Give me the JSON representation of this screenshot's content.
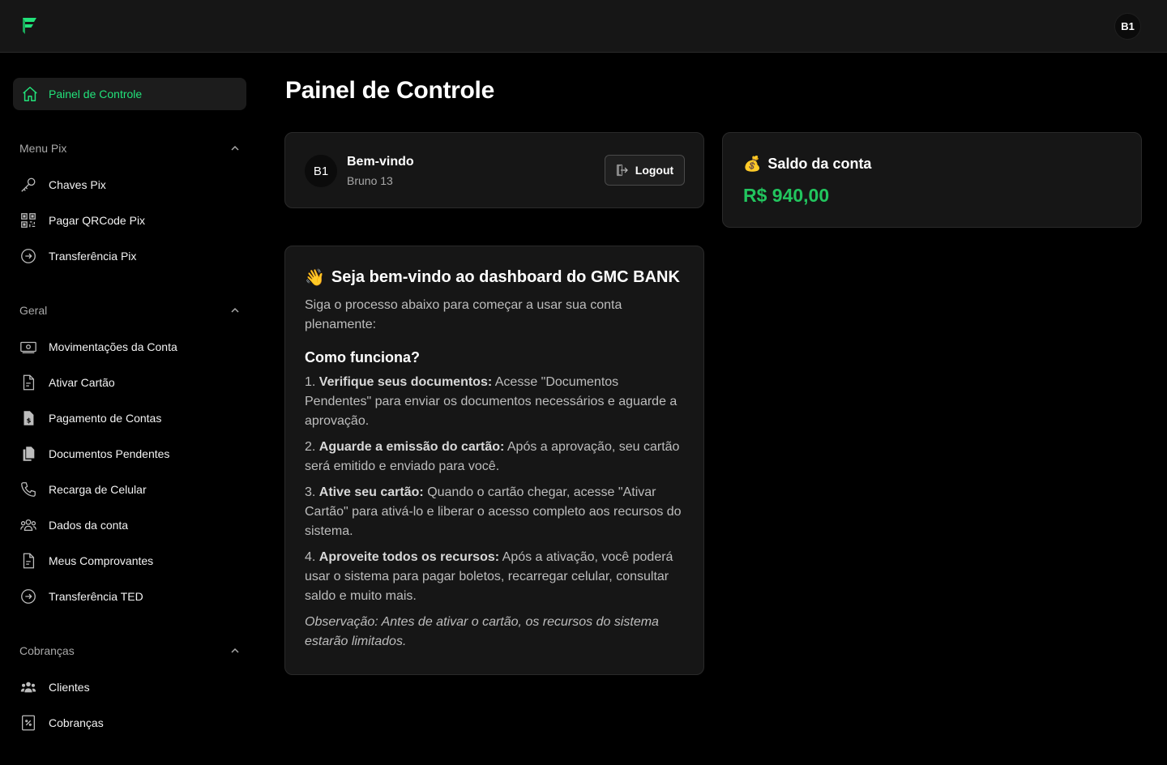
{
  "header": {
    "avatar_initials": "B1"
  },
  "sidebar": {
    "active_item": {
      "label": "Painel de Controle",
      "icon": "home-icon"
    },
    "groups": [
      {
        "title": "Menu Pix",
        "items": [
          {
            "label": "Chaves Pix",
            "icon": "key-icon"
          },
          {
            "label": "Pagar QRCode Pix",
            "icon": "qrcode-icon"
          },
          {
            "label": "Transferência Pix",
            "icon": "arrow-circle-icon"
          }
        ]
      },
      {
        "title": "Geral",
        "items": [
          {
            "label": "Movimentações da Conta",
            "icon": "banknote-icon"
          },
          {
            "label": "Ativar Cartão",
            "icon": "document-icon"
          },
          {
            "label": "Pagamento de Contas",
            "icon": "bill-icon"
          },
          {
            "label": "Documentos Pendentes",
            "icon": "documents-icon"
          },
          {
            "label": "Recarga de Celular",
            "icon": "phone-icon"
          },
          {
            "label": "Dados da conta",
            "icon": "users-icon"
          },
          {
            "label": "Meus Comprovantes",
            "icon": "receipt-icon"
          },
          {
            "label": "Transferência TED",
            "icon": "arrow-circle-icon"
          }
        ]
      },
      {
        "title": "Cobranças",
        "items": [
          {
            "label": "Clientes",
            "icon": "people-icon"
          },
          {
            "label": "Cobranças",
            "icon": "percent-receipt-icon"
          }
        ]
      }
    ]
  },
  "main": {
    "page_title": "Painel de Controle",
    "welcome": {
      "avatar_initials": "B1",
      "label": "Bem-vindo",
      "user_name": "Bruno 13",
      "logout_label": "Logout"
    },
    "balance": {
      "emoji": "💰",
      "title": "Saldo da conta",
      "value": "R$ 940,00"
    },
    "info": {
      "emoji": "👋",
      "heading": "Seja bem-vindo ao dashboard do GMC BANK",
      "subtitle": "Siga o processo abaixo para começar a usar sua conta plenamente:",
      "how_title": "Como funciona?",
      "steps": [
        {
          "number": "1.",
          "title": "Verifique seus documentos:",
          "text": "Acesse \"Documentos Pendentes\" para enviar os documentos necessários e aguarde a aprovação."
        },
        {
          "number": "2.",
          "title": "Aguarde a emissão do cartão:",
          "text": "Após a aprovação, seu cartão será emitido e enviado para você."
        },
        {
          "number": "3.",
          "title": "Ative seu cartão:",
          "text": "Quando o cartão chegar, acesse \"Ativar Cartão\" para ativá-lo e liberar o acesso completo aos recursos do sistema."
        },
        {
          "number": "4.",
          "title": "Aproveite todos os recursos:",
          "text": "Após a ativação, você poderá usar o sistema para pagar boletos, recarregar celular, consultar saldo e muito mais."
        }
      ],
      "note": "Observação: Antes de ativar o cartão, os recursos do sistema estarão limitados."
    }
  },
  "colors": {
    "accent": "#22e27a",
    "balance": "#22c55e",
    "background": "#000000",
    "card": "#161616"
  }
}
